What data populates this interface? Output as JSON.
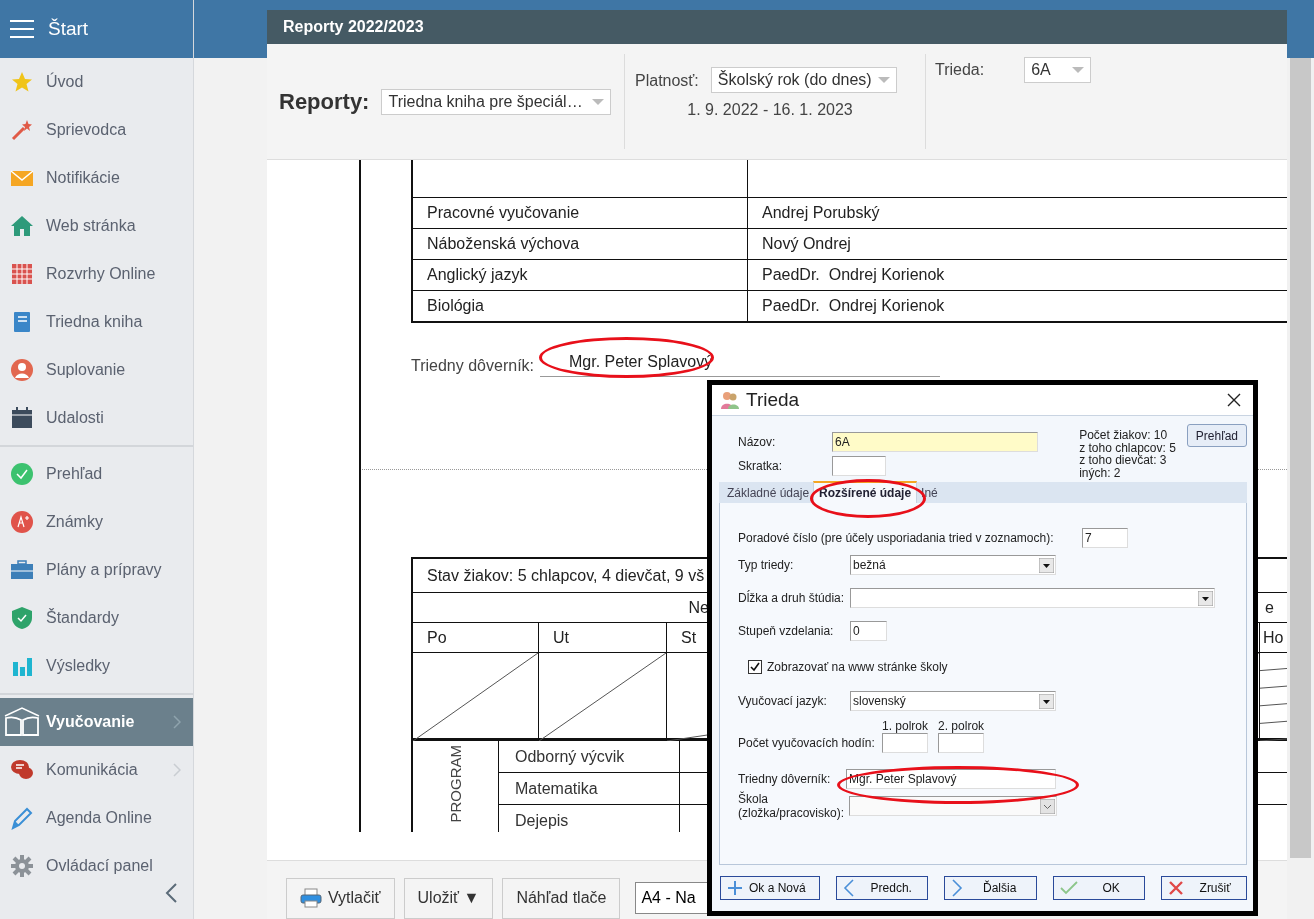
{
  "app_bar": {
    "title": "Štart"
  },
  "sidebar": {
    "groups": [
      {
        "items": [
          {
            "label": "Úvod",
            "selected": false,
            "submenu": false
          },
          {
            "label": "Sprievodca",
            "selected": false,
            "submenu": false
          },
          {
            "label": "Notifikácie",
            "selected": false,
            "submenu": false
          },
          {
            "label": "Web stránka",
            "selected": false,
            "submenu": false
          },
          {
            "label": "Rozvrhy Online",
            "selected": false,
            "submenu": false
          },
          {
            "label": "Triedna kniha",
            "selected": false,
            "submenu": false
          },
          {
            "label": "Suplovanie",
            "selected": false,
            "submenu": false
          },
          {
            "label": "Udalosti",
            "selected": false,
            "submenu": false
          }
        ]
      },
      {
        "items": [
          {
            "label": "Prehľad",
            "selected": false,
            "submenu": false
          },
          {
            "label": "Známky",
            "selected": false,
            "submenu": false
          },
          {
            "label": "Plány a prípravy",
            "selected": false,
            "submenu": false
          },
          {
            "label": "Štandardy",
            "selected": false,
            "submenu": false
          },
          {
            "label": "Výsledky",
            "selected": false,
            "submenu": false
          }
        ]
      },
      {
        "items": [
          {
            "label": "Vyučovanie",
            "selected": true,
            "submenu": true
          },
          {
            "label": "Komunikácia",
            "selected": false,
            "submenu": true
          },
          {
            "label": "Agenda Online",
            "selected": false,
            "submenu": false
          },
          {
            "label": "Ovládací panel",
            "selected": false,
            "submenu": false
          }
        ]
      }
    ]
  },
  "report": {
    "title": "Reporty 2022/2023",
    "report_label": "Reporty:",
    "report_select": "Triedna kniha pre špeciál…",
    "validity_label": "Platnosť:",
    "validity_select": "Školský rok (do dnes)",
    "date_range": "1. 9. 2022 - 16. 1. 2023",
    "class_label": "Trieda:",
    "class_select": "6A"
  },
  "document": {
    "teachers": [
      {
        "subject": "Pracovné vyučovanie",
        "teacher": "Andrej Porubský"
      },
      {
        "subject": "Náboženská výchova",
        "teacher": "Nový Ondrej"
      },
      {
        "subject": "Anglický jazyk",
        "teacher": "PaedDr.  Ondrej Korienok"
      },
      {
        "subject": "Biológia",
        "teacher": "PaedDr.  Ondrej Korienok"
      }
    ],
    "class_teacher_label": "Triedny dôverník:",
    "class_teacher": "Mgr. Peter Splavový",
    "timetable": {
      "summary": "Stav žiakov: 5 chlapcov, 4 dievčat, 9 vš",
      "week_left": "Ne",
      "week_right": "e",
      "days": [
        "Po",
        "Ut",
        "St"
      ],
      "hours_header": "Ho",
      "group_label": "PROGRAM",
      "subjects": [
        "Odborný výcvik",
        "Matematika",
        "Dejepis"
      ]
    }
  },
  "footer": {
    "buttons": [
      {
        "label": "Vytlačiť",
        "kind": "print"
      },
      {
        "label": "Uložiť ▼",
        "kind": "plain"
      },
      {
        "label": "Náhľad tlače",
        "kind": "plain"
      }
    ],
    "paper_select": "A4 - Na"
  },
  "dialog": {
    "title": "Trieda",
    "name_label": "Názov:",
    "name": "6A",
    "short_label": "Skratka:",
    "stats": [
      "Počet žiakov: 10",
      "z toho chlapcov: 5",
      "z toho dievčat: 3",
      "iných: 2"
    ],
    "overview_button": "Prehľad",
    "tabs": [
      {
        "label": "Základné údaje",
        "selected": false
      },
      {
        "label": "Rozšírené údaje",
        "selected": true
      },
      {
        "label": "Iné",
        "selected": false
      }
    ],
    "fields": [
      {
        "kind": "input",
        "label": "Poradové číslo (pre účely usporiadania tried v zoznamoch):",
        "value": "7"
      },
      {
        "kind": "select",
        "label": "Typ triedy:",
        "value": "bežná"
      },
      {
        "kind": "select",
        "label": "Dĺžka a druh štúdia:"
      },
      {
        "kind": "input",
        "label": "Stupeň vzdelania:",
        "value": "0"
      },
      {
        "kind": "checkbox",
        "label": "Zobrazovať na www stránke školy",
        "checked": true
      },
      {
        "kind": "select",
        "label": "Vyučovací jazyk:",
        "value": "slovenský"
      },
      {
        "kind": "pair",
        "label": "Počet vyučovacích hodín:",
        "columns": [
          "1. polrok",
          "2. polrok"
        ]
      },
      {
        "kind": "input",
        "label": "Triedny dôverník:",
        "value": "Mgr. Peter Splavový"
      },
      {
        "kind": "select",
        "label": "Škola (zložka/pracovisko):",
        "disabled": true
      }
    ],
    "buttons": [
      {
        "label": "Ok a Nová",
        "kind": "add"
      },
      {
        "label": "Predch.",
        "kind": "prev"
      },
      {
        "label": "Ďalšia",
        "kind": "next"
      },
      {
        "label": "OK",
        "kind": "ok"
      },
      {
        "label": "Zrušiť",
        "kind": "cancel"
      }
    ]
  }
}
